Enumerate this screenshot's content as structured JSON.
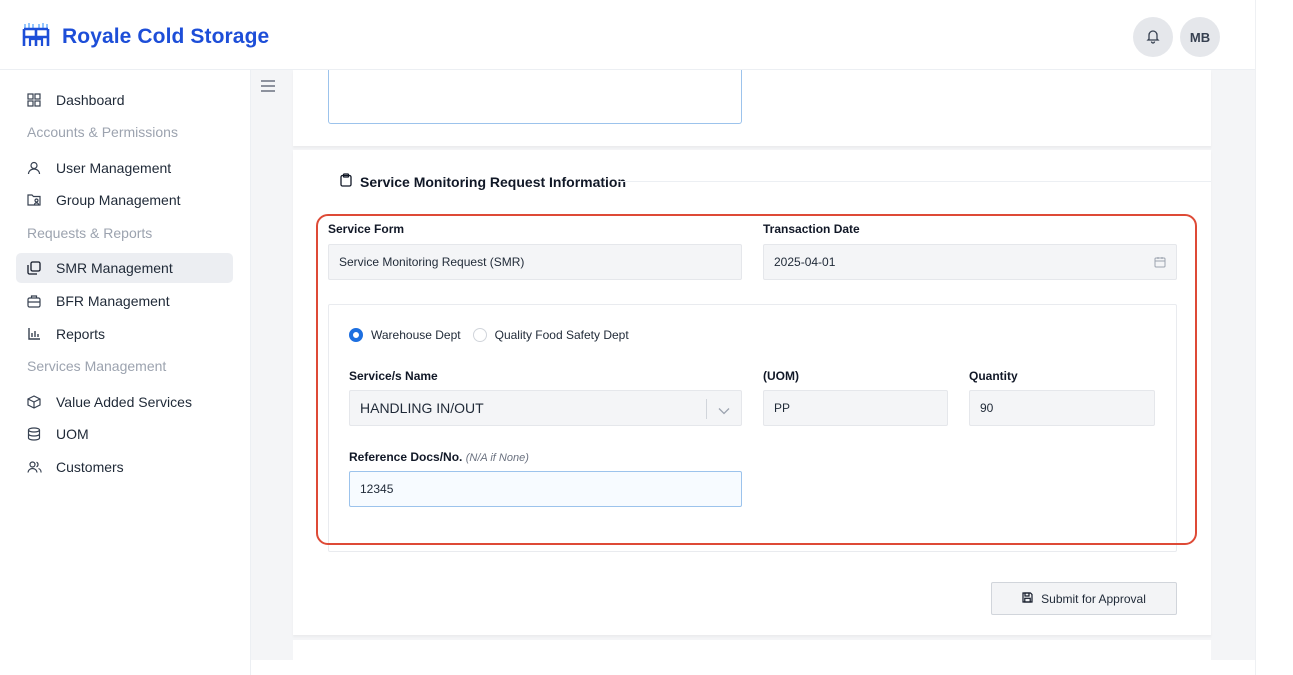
{
  "app": {
    "title": "Royale Cold Storage"
  },
  "header": {
    "avatar_initials": "MB"
  },
  "sidebar": {
    "items": [
      {
        "label": "Dashboard",
        "icon": "dashboard-icon"
      },
      {
        "section": "Accounts & Permissions"
      },
      {
        "label": "User Management",
        "icon": "user-icon"
      },
      {
        "label": "Group Management",
        "icon": "group-icon"
      },
      {
        "section": "Requests & Reports"
      },
      {
        "label": "SMR Management",
        "icon": "copy-icon",
        "active": true
      },
      {
        "label": "BFR Management",
        "icon": "briefcase-icon"
      },
      {
        "label": "Reports",
        "icon": "bar-chart-icon"
      },
      {
        "section": "Services Management"
      },
      {
        "label": "Value Added Services",
        "icon": "box-icon"
      },
      {
        "label": "UOM",
        "icon": "database-icon"
      },
      {
        "label": "Customers",
        "icon": "users-icon"
      }
    ]
  },
  "form": {
    "section_title": "Service Monitoring Request Information",
    "service_form": {
      "label": "Service Form",
      "value": "Service Monitoring Request (SMR)"
    },
    "transaction_date": {
      "label": "Transaction Date",
      "value": "2025-04-01"
    },
    "departments": {
      "options": [
        "Warehouse Dept",
        "Quality Food Safety Dept"
      ],
      "selected": "Warehouse Dept"
    },
    "service_name": {
      "label": "Service/s Name",
      "value": "HANDLING IN/OUT"
    },
    "uom": {
      "label": "(UOM)",
      "value": "PP"
    },
    "quantity": {
      "label": "Quantity",
      "value": "90"
    },
    "reference": {
      "label": "Reference Docs/No.",
      "hint": "(N/A if None)",
      "value": "12345"
    },
    "submit_label": "Submit for Approval"
  },
  "colors": {
    "brand": "#1d4ed8",
    "highlight": "#de4a36",
    "radio_active": "#1d6fe0"
  }
}
